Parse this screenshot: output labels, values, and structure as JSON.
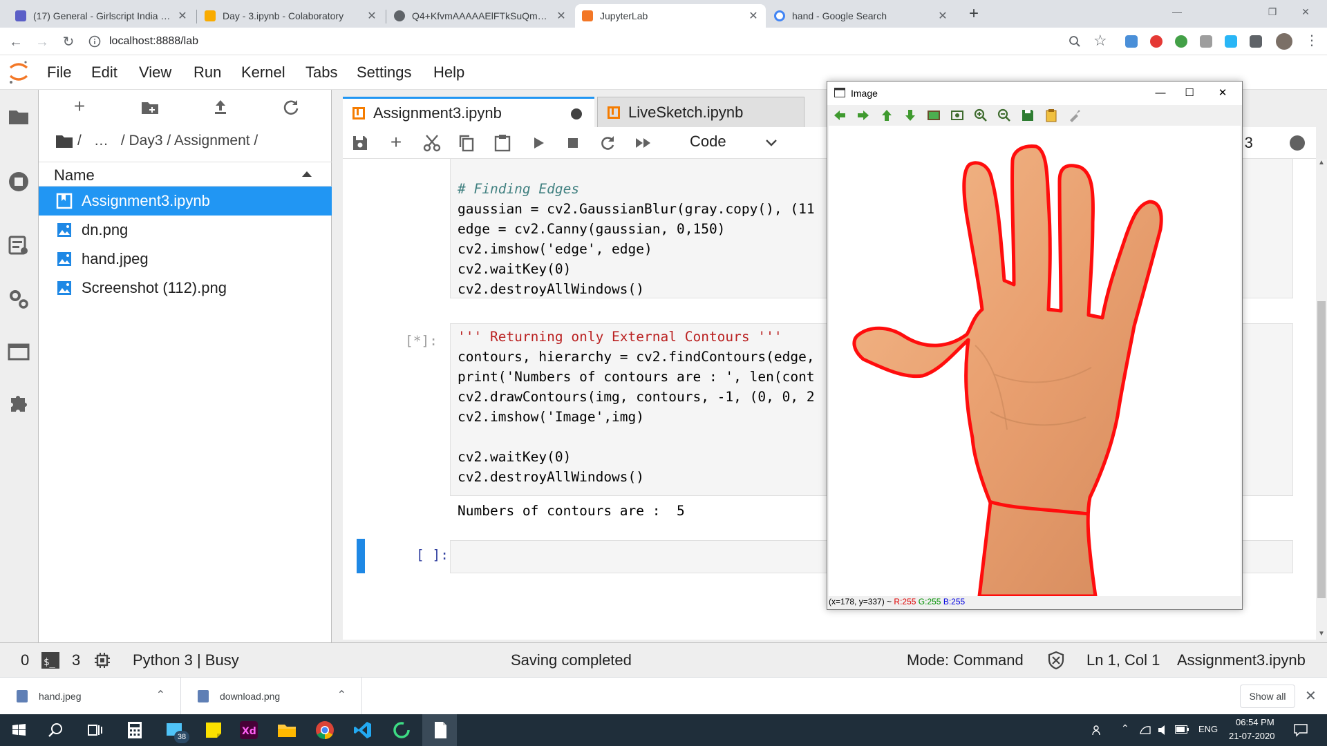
{
  "browser": {
    "tabs": [
      {
        "title": "(17) General - Girlscript India Sur",
        "favicon_color": "#5b5fc7"
      },
      {
        "title": "Day - 3.ipynb - Colaboratory",
        "favicon_color": "#f9ab00"
      },
      {
        "title": "Q4+KfvmAAAAAElFTkSuQmCC (",
        "favicon_color": "#5f6368"
      },
      {
        "title": "JupyterLab",
        "favicon_color": "#f37726",
        "active": true
      },
      {
        "title": "hand - Google Search",
        "favicon_color": "#4285f4"
      }
    ],
    "url": "localhost:8888/lab"
  },
  "jupyter": {
    "menu": [
      "File",
      "Edit",
      "View",
      "Run",
      "Kernel",
      "Tabs",
      "Settings",
      "Help"
    ],
    "breadcrumb": [
      "/",
      "…",
      "/ Day3 / Assignment /"
    ],
    "name_header": "Name",
    "files": [
      {
        "name": "Assignment3.ipynb",
        "selected": true,
        "kind": "notebook"
      },
      {
        "name": "dn.png",
        "kind": "image"
      },
      {
        "name": "hand.jpeg",
        "kind": "image"
      },
      {
        "name": "Screenshot (112).png",
        "kind": "image"
      }
    ],
    "notebook_tabs": [
      "Assignment3.ipynb",
      "LiveSketch.ipynb"
    ],
    "cell_type": "Code",
    "kernel_label": "on 3",
    "cells": [
      {
        "prompt": "",
        "lines": [
          "# Finding Edges",
          "gaussian = cv2.GaussianBlur(gray.copy(), (11",
          "edge = cv2.Canny(gaussian, 0,150)",
          "cv2.imshow('edge', edge)",
          "cv2.waitKey(0)",
          "cv2.destroyAllWindows()"
        ]
      },
      {
        "prompt": "[*]:",
        "lines": [
          "''' Returning only External Contours '''",
          "contours, hierarchy = cv2.findContours(edge,",
          "print('Numbers of contours are : ', len(cont",
          "cv2.drawContours(img, contours, -1, (0, 0, 2",
          "cv2.imshow('Image',img)",
          "",
          "cv2.waitKey(0)",
          "cv2.destroyAllWindows()"
        ]
      },
      {
        "prompt": "[ ]:",
        "lines": []
      }
    ],
    "output": "Numbers of contours are :  5"
  },
  "cv_window": {
    "title": "Image",
    "status_prefix": "(x=178, y=337) ~ ",
    "status_r": "R:255",
    "status_g": "G:255",
    "status_b": "B:255"
  },
  "statusbar": {
    "zero": "0",
    "terminals": "3",
    "kernel": "Python 3 | Busy",
    "saving": "Saving completed",
    "mode": "Mode: Command",
    "position": "Ln 1, Col 1",
    "file": "Assignment3.ipynb"
  },
  "downloads": {
    "items": [
      "hand.jpeg",
      "download.png"
    ],
    "show_all": "Show all"
  },
  "taskbar": {
    "badge": "38",
    "lang": "ENG",
    "time": "06:54 PM",
    "date": "21-07-2020"
  }
}
